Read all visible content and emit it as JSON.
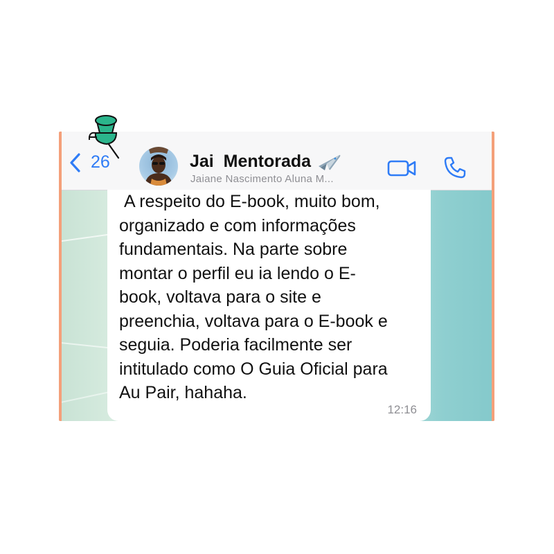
{
  "header": {
    "back_count": "26",
    "contact_name": "Jai  Mentorada",
    "contact_subtitle": "Jaiane Nascimento Aluna M..."
  },
  "message": {
    "text": " A respeito do E-book, muito bom,\norganizado e com informações\nfundamentais. Na parte sobre\nmontar o perfil eu ia lendo o E-\nbook, voltava para o site e\npreenchia, voltava para o E-book e\nseguia. Poderia facilmente ser\nintitulado como O Guia Oficial para\nAu Pair, hahaha.",
    "time": "12:16"
  },
  "icons": {
    "back": "chevron-left-icon",
    "plane": "airplane-emoji-icon",
    "video": "video-camera-icon",
    "call": "phone-icon",
    "pin": "pushpin-icon"
  },
  "colors": {
    "accent": "#2f7cf6",
    "pin": "#2bb58c",
    "header_bg": "#f7f7f8",
    "chat_bg": "#dceee4"
  }
}
